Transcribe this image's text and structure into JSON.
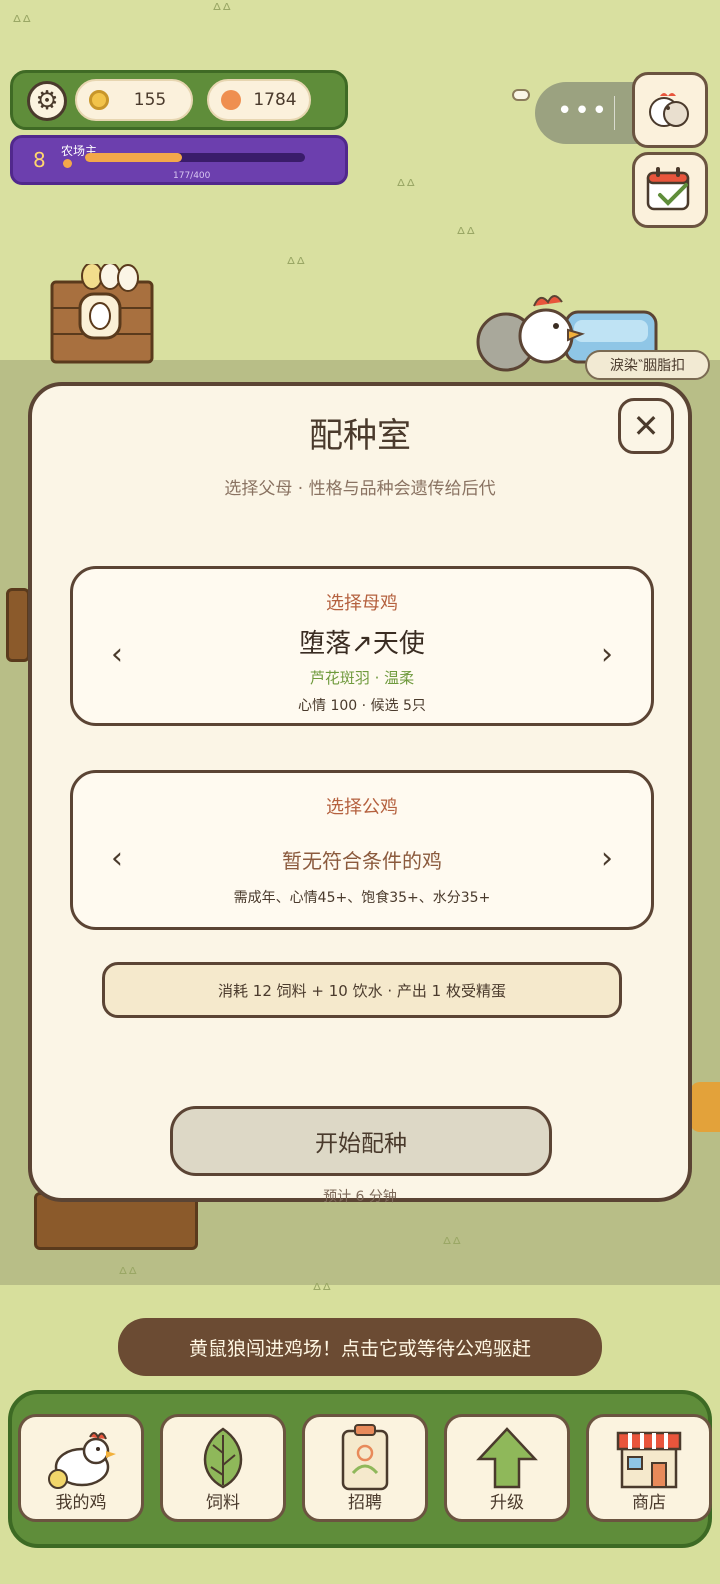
{
  "hud": {
    "coins": "155",
    "gems": "1784",
    "level": "8",
    "level_title": "农场主",
    "xp_text": "177/400",
    "xp_progress": 0.4425
  },
  "decor": {
    "tag_label": "淚染‶胭脂扣"
  },
  "modal": {
    "title": "配种室",
    "subtitle": "选择父母 · 性格与品种会遗传给后代",
    "close_label": "✕",
    "hen": {
      "label": "选择母鸡",
      "name": "堕落↗天使",
      "trait": "芦花斑羽 · 温柔",
      "stats": "心情 100 · 候选 5只",
      "prev": "‹",
      "next": "›"
    },
    "rooster": {
      "label": "选择公鸡",
      "empty_text": "暂无符合条件的鸡",
      "requirement": "需成年、心情45+、饱食35+、水分35+",
      "prev": "‹",
      "next": "›"
    },
    "cost": "消耗 12 饲料 + 10 饮水 · 产出 1 枚受精蛋",
    "start_button": "开始配种",
    "eta": "预计 6 分钟"
  },
  "notice": "黄鼠狼闯进鸡场！点击它或等待公鸡驱赶",
  "nav": [
    {
      "label": "我的鸡",
      "icon": "chicken-icon"
    },
    {
      "label": "饲料",
      "icon": "leaf-icon"
    },
    {
      "label": "招聘",
      "icon": "badge-icon"
    },
    {
      "label": "升级",
      "icon": "up-arrow-icon"
    },
    {
      "label": "商店",
      "icon": "shop-icon"
    }
  ],
  "colors": {
    "accent_green": "#5f8d3a",
    "level_purple": "#6c3fae",
    "label_orange": "#b5613f",
    "trait_green": "#6f9a3d"
  }
}
